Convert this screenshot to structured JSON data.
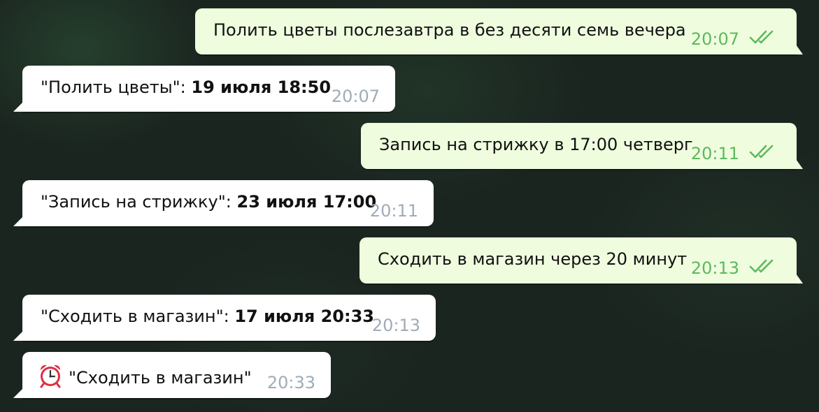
{
  "colors": {
    "incoming_bubble": "#ffffff",
    "outgoing_bubble": "#effdde",
    "incoming_time": "#a0acb6",
    "outgoing_time": "#5db95d",
    "read_check": "#5db95d"
  },
  "messages": [
    {
      "direction": "out",
      "text": "Полить цветы послезавтра в без десяти семь вечера",
      "time": "20:07",
      "status_icon": "double-check-icon"
    },
    {
      "direction": "in",
      "text": "\"Полить цветы\": ",
      "bold": "19 июля 18:50",
      "time": "20:07"
    },
    {
      "direction": "out",
      "text": "Запись на стрижку в 17:00 четверг",
      "time": "20:11",
      "status_icon": "double-check-icon"
    },
    {
      "direction": "in",
      "text": "\"Запись на стрижку\": ",
      "bold": "23 июля 17:00",
      "time": "20:11"
    },
    {
      "direction": "out",
      "text": "Сходить в магазин через 20 минут",
      "time": "20:13",
      "status_icon": "double-check-icon"
    },
    {
      "direction": "in",
      "text": "\"Сходить в магазин\": ",
      "bold": "17 июля 20:33",
      "time": "20:13"
    },
    {
      "direction": "in",
      "icon": "alarm-clock-icon",
      "text": "\"Сходить в магазин\"",
      "time": "20:33"
    }
  ]
}
